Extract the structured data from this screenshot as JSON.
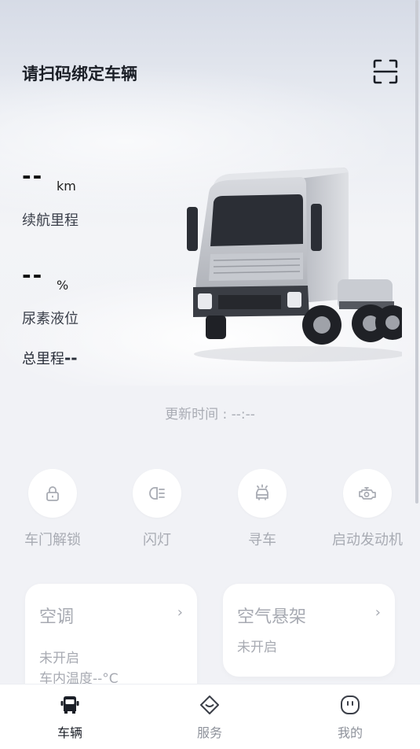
{
  "header": {
    "title": "请扫码绑定车辆",
    "scan_icon": "scan-icon"
  },
  "stats": {
    "range": {
      "value": "--",
      "unit": "km",
      "label": "续航里程"
    },
    "urea": {
      "value": "--",
      "unit": "%",
      "label": "尿素液位"
    },
    "odometer": {
      "label": "总里程",
      "value": "--"
    }
  },
  "update_time": "更新时间 : --:--",
  "actions": [
    {
      "label": "车门解锁",
      "icon": "lock-icon"
    },
    {
      "label": "闪灯",
      "icon": "headlight-icon"
    },
    {
      "label": "寻车",
      "icon": "find-car-icon"
    },
    {
      "label": "启动发动机",
      "icon": "engine-icon"
    }
  ],
  "cards": {
    "ac": {
      "title": "空调",
      "status": "未开启",
      "temp": "车内温度--°C"
    },
    "suspension": {
      "title": "空气悬架",
      "status": "未开启"
    }
  },
  "tabs": [
    {
      "label": "车辆",
      "icon": "truck-icon",
      "active": true
    },
    {
      "label": "服务",
      "icon": "service-icon",
      "active": false
    },
    {
      "label": "我的",
      "icon": "profile-icon",
      "active": false
    }
  ],
  "colors": {
    "accent": "#1b1f27",
    "muted": "#a8abb3",
    "background": "#f1f2f6"
  }
}
